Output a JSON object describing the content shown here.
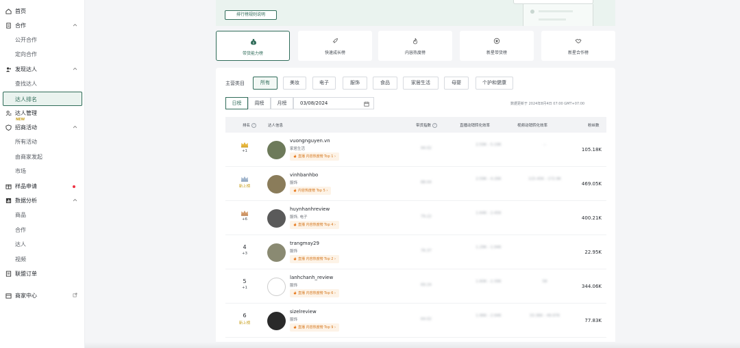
{
  "sidebar": {
    "items": [
      {
        "label": "首页",
        "icon": "home-icon",
        "type": "top"
      },
      {
        "label": "合作",
        "icon": "doc-icon",
        "type": "group"
      },
      {
        "label": "公开合作",
        "type": "sub"
      },
      {
        "label": "定向合作",
        "type": "sub"
      },
      {
        "label": "发现达人",
        "icon": "users-icon",
        "type": "group"
      },
      {
        "label": "查找达人",
        "type": "sub"
      },
      {
        "label": "达人排名",
        "type": "sub",
        "active": true
      },
      {
        "label": "达人管理",
        "icon": "user-manage-icon",
        "type": "top"
      },
      {
        "label": "招商活动",
        "icon": "shield-icon",
        "type": "group"
      },
      {
        "label": "所有活动",
        "type": "sub"
      },
      {
        "label": "由商家发起",
        "type": "sub"
      },
      {
        "label": "市场",
        "type": "sub"
      },
      {
        "label": "样品申请",
        "icon": "box-icon",
        "type": "top"
      },
      {
        "label": "数据分析",
        "icon": "chart-icon",
        "type": "group"
      },
      {
        "label": "商品",
        "type": "sub"
      },
      {
        "label": "合作",
        "type": "sub"
      },
      {
        "label": "达人",
        "type": "sub"
      },
      {
        "label": "视频",
        "type": "sub"
      },
      {
        "label": "联盟订单",
        "icon": "order-icon",
        "type": "top"
      },
      {
        "label": "商家中心",
        "icon": "store-icon",
        "type": "top"
      }
    ],
    "new_tag": "NEW"
  },
  "rules_button": "排行榜规则说明",
  "ranking_tabs": [
    {
      "label": "带货能力榜",
      "icon": "money-bag-icon",
      "active": true
    },
    {
      "label": "快速成长榜",
      "icon": "rocket-icon"
    },
    {
      "label": "内容热度榜",
      "icon": "flame-icon"
    },
    {
      "label": "新星带货榜",
      "icon": "star-badge-icon"
    },
    {
      "label": "新星合作榜",
      "icon": "handshake-icon"
    }
  ],
  "filters": {
    "category_label": "主营类目",
    "categories": [
      {
        "label": "所有",
        "active": true
      },
      {
        "label": "美妆"
      },
      {
        "label": "电子"
      },
      {
        "label": "服饰"
      },
      {
        "label": "食品"
      },
      {
        "label": "家居生活"
      },
      {
        "label": "母婴"
      },
      {
        "label": "个护和健康"
      }
    ],
    "periods": [
      {
        "label": "日榜",
        "active": true
      },
      {
        "label": "周榜"
      },
      {
        "label": "月榜"
      }
    ],
    "date": "03/08/2024",
    "update_time": "数据更新于 2024年8月4日 07:00 GMT+07:00"
  },
  "table": {
    "headers": [
      "排名",
      "达人信息",
      "带货指数",
      "直播动销转化效率",
      "视频动销转化效率",
      "粉丝数"
    ],
    "rows": [
      {
        "rank": "",
        "crown": "gold",
        "change": "+1",
        "name": "vuongnguyen.vn",
        "cats": "家居生活",
        "badge": "直播 内容热度榜 Top 1",
        "index": "94.02",
        "live": "2.59K - 5.19K",
        "video": "--",
        "fans": "105.18K"
      },
      {
        "rank": "",
        "crown": "silver",
        "change": "新上榜",
        "name": "vinhbanhbo",
        "cats": "服饰",
        "badge": "内容热度榜 Top 5",
        "index": "88.04",
        "live": "2.59K - 4.26K",
        "video": "115.45K - 172.9K",
        "fans": "469.05K"
      },
      {
        "rank": "",
        "crown": "bronze",
        "change": "+6",
        "name": "huynhanhreview",
        "cats": "服饰, 电子",
        "badge": "直播 内容热度榜 Top 4",
        "index": "79.22",
        "live": "1.64K - 2.45K",
        "video": "",
        "fans": "400.21K"
      },
      {
        "rank": "4",
        "crown": "",
        "change": "+3",
        "name": "trangmay29",
        "cats": "服饰",
        "badge": "直播 内容热度榜 Top 2",
        "index": "76.37",
        "live": "1.29K - 1.94K",
        "video": "",
        "fans": "22.95K"
      },
      {
        "rank": "5",
        "crown": "",
        "change": "+1",
        "name": "lanhchanh_review",
        "cats": "服饰",
        "badge": "直播 内容热度榜 Top 6",
        "index": "69.24",
        "live": "1.60K - 2.39K",
        "video": "58",
        "fans": "344.06K"
      },
      {
        "rank": "6",
        "crown": "",
        "change": "新上榜",
        "name": "sizelreview",
        "cats": "服饰",
        "badge": "直播 内容热度榜 Top 9",
        "index": "64.02",
        "live": "1.96K - 2.94K",
        "video": "33.36K - 49.97K",
        "fans": "77.83K"
      }
    ]
  }
}
